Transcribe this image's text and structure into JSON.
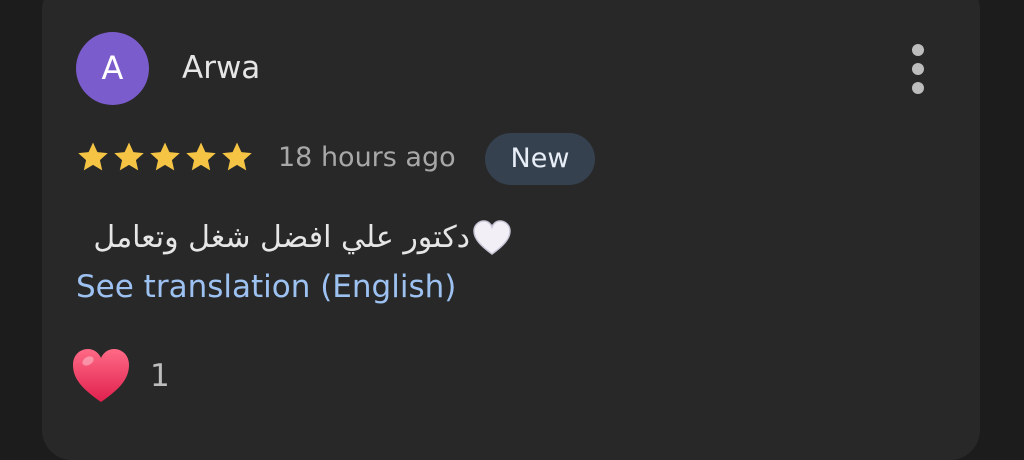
{
  "review": {
    "avatar_initial": "A",
    "reviewer_name": "Arwa",
    "rating": 5,
    "rating_max": 5,
    "time_ago": "18 hours ago",
    "badge": "New",
    "text": "دكتور علي افضل شغل وتعامل",
    "translate_link": "See translation (English)",
    "like_count": "1"
  },
  "icons": {
    "more": "more-vertical-icon",
    "star": "star-icon",
    "emoji": "white-heart-icon",
    "like": "red-heart-icon"
  },
  "colors": {
    "avatar": "#7b5ccc",
    "star": "#f5c444",
    "link": "#9dc2f2",
    "badge_bg": "#36414f",
    "like_heart": "#f23a62"
  }
}
